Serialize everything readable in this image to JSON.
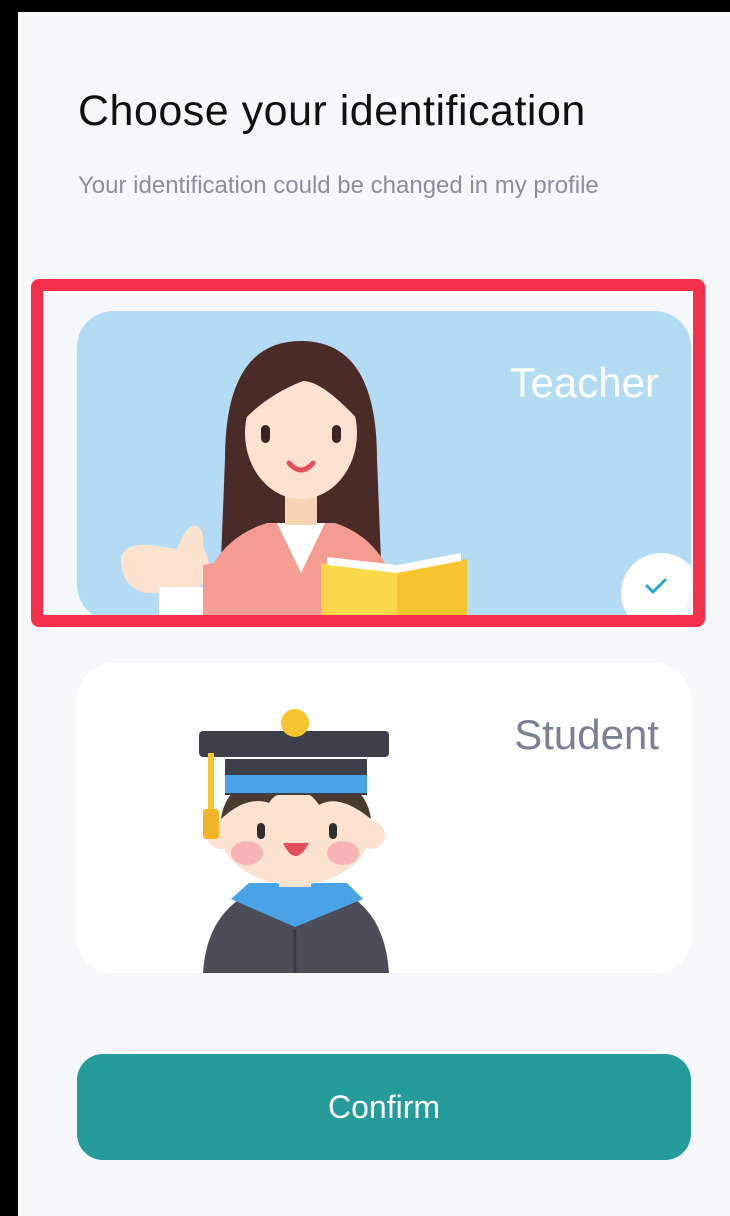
{
  "header": {
    "title": "Choose your identification",
    "subtitle": "Your identification could be changed in my profile"
  },
  "options": [
    {
      "label": "Teacher",
      "selected": true,
      "icon": "teacher-illustration"
    },
    {
      "label": "Student",
      "selected": false,
      "icon": "student-illustration"
    }
  ],
  "confirm_label": "Confirm",
  "colors": {
    "accent": "#259b9a",
    "selected_card": "#b3dcf4",
    "highlight": "#f5304b"
  }
}
